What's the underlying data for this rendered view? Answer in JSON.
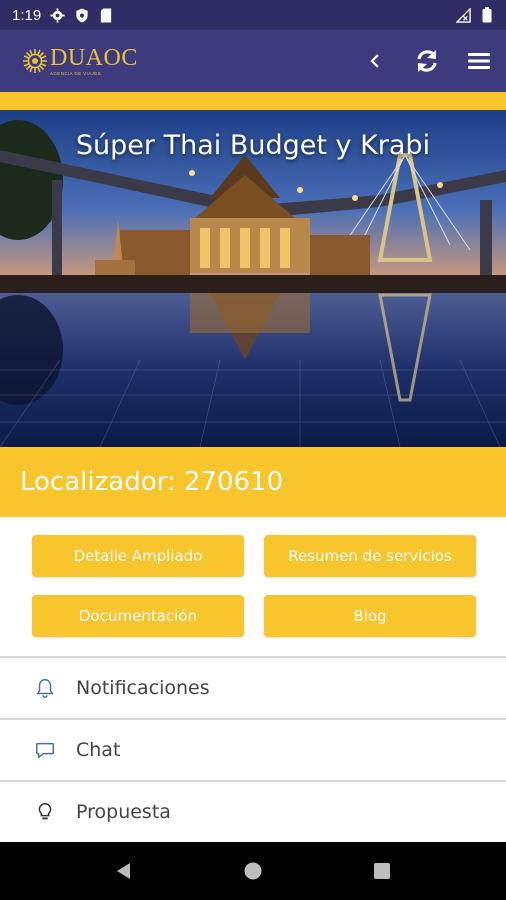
{
  "status_bar": {
    "time": "1:19",
    "icons": [
      "gear-icon",
      "shield-icon",
      "sd-card-icon",
      "signal-icon",
      "battery-icon"
    ]
  },
  "header": {
    "logo_text": "DUAOC",
    "logo_tagline": "AGENCIA DE VIAJES",
    "actions": [
      "back-icon",
      "refresh-icon",
      "menu-icon"
    ]
  },
  "hero": {
    "title": "Súper Thai Budget y Krabi"
  },
  "booking": {
    "locator": "Localizador: 270610"
  },
  "buttons": {
    "detail": "Detalle Ampliado",
    "summary": "Resumen de servicios",
    "docs": "Documentación",
    "blog": "Blog"
  },
  "list": [
    {
      "label": "Notificaciones",
      "icon": "bell-icon"
    },
    {
      "label": "Chat",
      "icon": "chat-icon"
    },
    {
      "label": "Propuesta",
      "icon": "lightbulb-icon"
    }
  ],
  "nav": [
    "back-triangle-icon",
    "home-circle-icon",
    "recents-square-icon"
  ],
  "colors": {
    "primary": "#3d3a7e",
    "status_bar": "#2f2c66",
    "accent": "#f9c52c",
    "logo": "#e9c13a"
  }
}
